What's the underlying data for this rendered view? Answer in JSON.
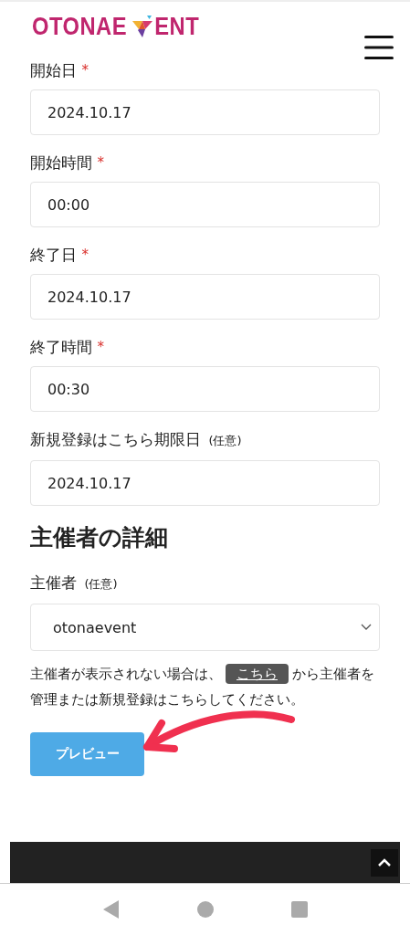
{
  "header": {
    "logo_start": "OTONAE",
    "logo_end": "ENT"
  },
  "fields": [
    {
      "label": "開始日",
      "required_mark": "*",
      "value": "2024.10.17"
    },
    {
      "label": "開始時間",
      "required_mark": "*",
      "value": "00:00"
    },
    {
      "label": "終了日",
      "required_mark": "*",
      "value": "2024.10.17"
    },
    {
      "label": "終了時間",
      "required_mark": "*",
      "value": "00:30"
    },
    {
      "label": "新規登録はこちら期限日",
      "optional_note": "(任意)",
      "value": "2024.10.17"
    }
  ],
  "organizer_section": {
    "heading": "主催者の詳細",
    "label": "主催者",
    "optional_note": "(任意)",
    "select_value": "otonaevent",
    "help_before": "主催者が表示されない場合は、",
    "help_link": "こちら",
    "help_after": "から主催者を管理または新規登録はこちらしてください。"
  },
  "preview_button": "プレビュー"
}
